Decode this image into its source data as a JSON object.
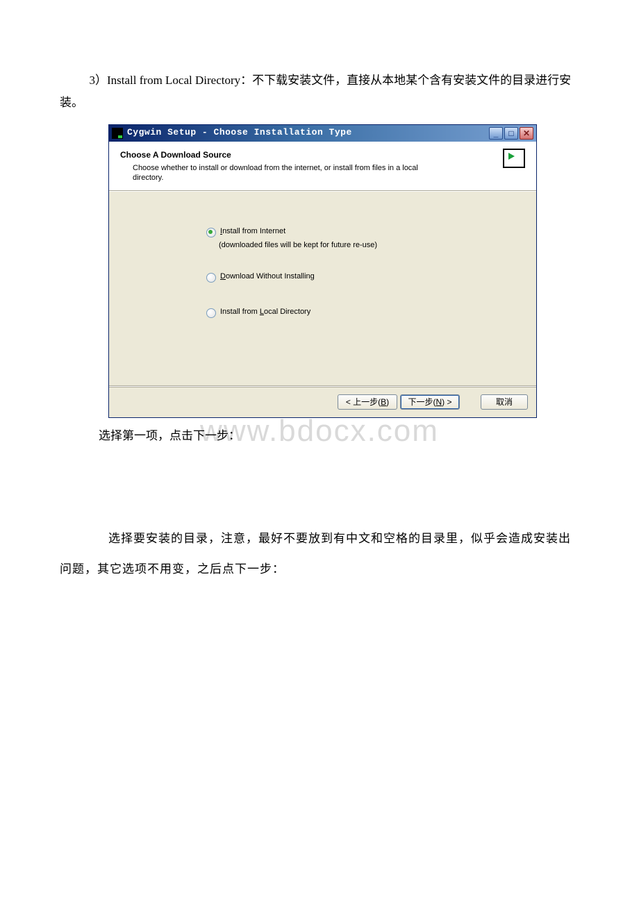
{
  "intro": {
    "line1": "3）Install from Local Directory：不下载安装文件，直接从本地某个含有安装文件的目录进行安装。"
  },
  "dialog": {
    "title": "Cygwin Setup - Choose Installation Type",
    "header": {
      "title": "Choose A Download Source",
      "desc": "Choose whether to install or download from the internet, or install from files in a local directory."
    },
    "options": {
      "o1_pre": "",
      "o1_m": "I",
      "o1_post": "nstall from Internet",
      "o1_sub": "(downloaded files will be kept for future re-use)",
      "o2_pre": "",
      "o2_m": "D",
      "o2_post": "ownload Without Installing",
      "o3_pre": "Install from ",
      "o3_m": "L",
      "o3_post": "ocal Directory"
    },
    "buttons": {
      "back_pre": "< 上一步(",
      "back_m": "B",
      "back_post": ")",
      "next_pre": "下一步(",
      "next_m": "N",
      "next_post": ") >",
      "cancel": "取消"
    }
  },
  "caption": "选择第一项，点击下一步：",
  "watermark": "www.bdocx.com",
  "para2": "　　选择要安装的目录，注意，最好不要放到有中文和空格的目录里，似乎会造成安装出问题，其它选项不用变，之后点下一步："
}
